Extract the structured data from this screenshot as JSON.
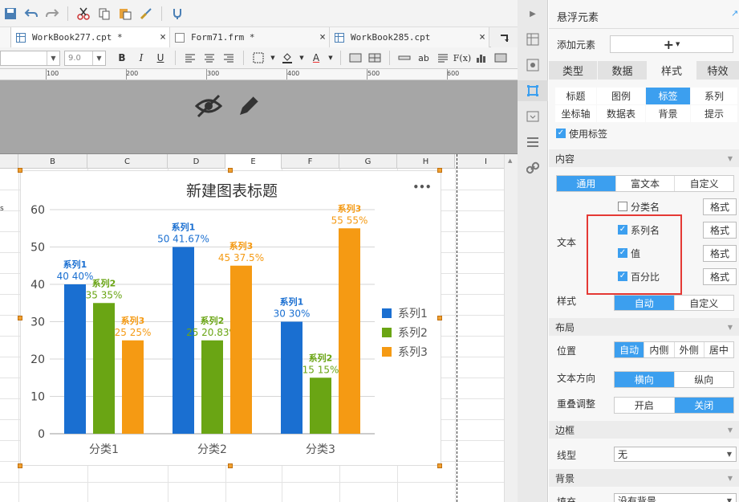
{
  "toolbar": {
    "zoom_font_size": "9.0",
    "font_name": ""
  },
  "tabs": [
    {
      "label": "WorkBook277.cpt *"
    },
    {
      "label": "Form71.frm *"
    },
    {
      "label": "WorkBook285.cpt"
    }
  ],
  "ruler": {
    "labels": [
      "100",
      "200",
      "300",
      "400",
      "500",
      "600"
    ]
  },
  "columns": [
    "B",
    "C",
    "D",
    "E",
    "F",
    "G",
    "H",
    "I"
  ],
  "sheet": {
    "cell_text": "s"
  },
  "chart_data": {
    "type": "bar",
    "title": "新建图表标题",
    "categories": [
      "分类1",
      "分类2",
      "分类3"
    ],
    "ylim": [
      0,
      60
    ],
    "yticks": [
      0,
      10,
      20,
      30,
      40,
      50,
      60
    ],
    "series": [
      {
        "name": "系列1",
        "color": "#1a6fd1",
        "values": [
          40,
          50,
          30
        ],
        "percent": [
          "40%",
          "41.67%",
          "30%"
        ]
      },
      {
        "name": "系列2",
        "color": "#6aa514",
        "values": [
          35,
          25,
          15
        ],
        "percent": [
          "35%",
          "20.83%",
          "15%"
        ]
      },
      {
        "name": "系列3",
        "color": "#f59a13",
        "values": [
          25,
          45,
          55
        ],
        "percent": [
          "25%",
          "37.5%",
          "55%"
        ]
      }
    ],
    "legend": "right",
    "more": "•••"
  },
  "panel": {
    "title": "悬浮元素",
    "add_element_label": "添加元素",
    "add_element_button": "+",
    "main_tabs": [
      "类型",
      "数据",
      "样式",
      "特效"
    ],
    "active_main_tab": "样式",
    "sub_tabs": [
      "标题",
      "图例",
      "标签",
      "系列",
      "坐标轴",
      "数据表",
      "背景",
      "提示"
    ],
    "active_sub_tab": "标签",
    "use_label": "使用标签",
    "content_section": "内容",
    "content_modes": [
      "通用",
      "富文本",
      "自定义"
    ],
    "text_label": "文本",
    "checks": [
      {
        "label": "分类名",
        "checked": false
      },
      {
        "label": "系列名",
        "checked": true
      },
      {
        "label": "值",
        "checked": true
      },
      {
        "label": "百分比",
        "checked": true
      }
    ],
    "format_button": "格式",
    "style_label": "样式",
    "style_modes": [
      "自动",
      "自定义"
    ],
    "layout_section": "布局",
    "position_label": "位置",
    "position_modes": [
      "自动",
      "内侧",
      "外侧",
      "居中"
    ],
    "text_dir_label": "文本方向",
    "text_dir_modes": [
      "横向",
      "纵向"
    ],
    "overlap_label": "重叠调整",
    "overlap_modes": [
      "开启",
      "关闭"
    ],
    "border_section": "边框",
    "line_label": "线型",
    "line_value": "无",
    "bg_section": "背景",
    "fill_label": "填充",
    "fill_value": "没有背景"
  }
}
